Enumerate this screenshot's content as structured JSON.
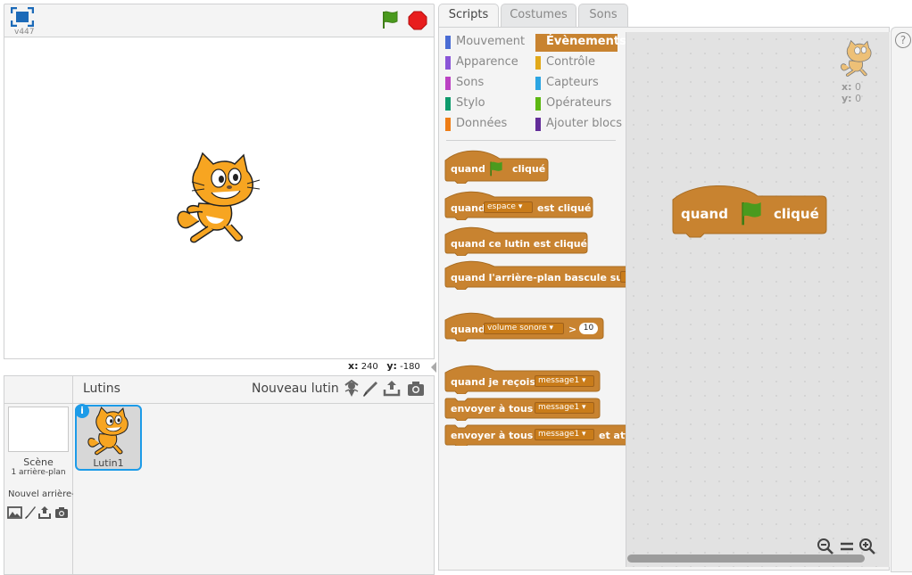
{
  "stage": {
    "version": "v447",
    "coords": {
      "x_label": "x:",
      "x_value": "240",
      "y_label": "y:",
      "y_value": "-180"
    }
  },
  "sprites": {
    "title": "Lutins",
    "new_sprite_label": "Nouveau lutin",
    "scene_label": "Scène",
    "scene_count": "1 arrière-plan",
    "new_backdrop_label": "Nouvel arrière-plan",
    "selected_sprite": {
      "name": "Lutin1",
      "info": "i"
    }
  },
  "tabs": [
    {
      "label": "Scripts"
    },
    {
      "label": "Costumes"
    },
    {
      "label": "Sons"
    }
  ],
  "categories": [
    {
      "label": "Mouvement",
      "color": "#4a6cd4"
    },
    {
      "label": "Évènements",
      "color": "#c88330"
    },
    {
      "label": "Apparence",
      "color": "#8a55d7"
    },
    {
      "label": "Contrôle",
      "color": "#e1a91a"
    },
    {
      "label": "Sons",
      "color": "#bb42c3"
    },
    {
      "label": "Capteurs",
      "color": "#2ca5e2"
    },
    {
      "label": "Stylo",
      "color": "#0e9a6c"
    },
    {
      "label": "Opérateurs",
      "color": "#5cb712"
    },
    {
      "label": "Données",
      "color": "#ee7d16"
    },
    {
      "label": "Ajouter blocs",
      "color": "#632d99"
    }
  ],
  "blocks": {
    "when_flag": {
      "pre": "quand",
      "post": "cliqué"
    },
    "when_key": {
      "pre": "quand",
      "dropdown": "espace",
      "post": "est cliqué"
    },
    "when_sprite": {
      "text": "quand ce lutin est cliqué"
    },
    "when_backdrop": {
      "text": "quand l'arrière-plan bascule sur"
    },
    "when_sensor": {
      "pre": "quand",
      "dropdown": "volume sonore",
      "op": ">",
      "value": "10"
    },
    "when_receive": {
      "pre": "quand je reçois",
      "dropdown": "message1"
    },
    "broadcast": {
      "pre": "envoyer à tous",
      "dropdown": "message1"
    },
    "broadcast_wait": {
      "pre": "envoyer à tous",
      "dropdown": "message1",
      "post": "et attendre"
    }
  },
  "script": {
    "pre": "quand",
    "post": "cliqué"
  },
  "xy_readout": {
    "x_label": "x:",
    "x_value": "0",
    "y_label": "y:",
    "y_value": "0"
  },
  "help": {
    "label": "?"
  },
  "colors": {
    "events": "#c88330",
    "selection": "#1c9be8",
    "stop": "#e81d1d",
    "flag": "#4a9a1e"
  }
}
